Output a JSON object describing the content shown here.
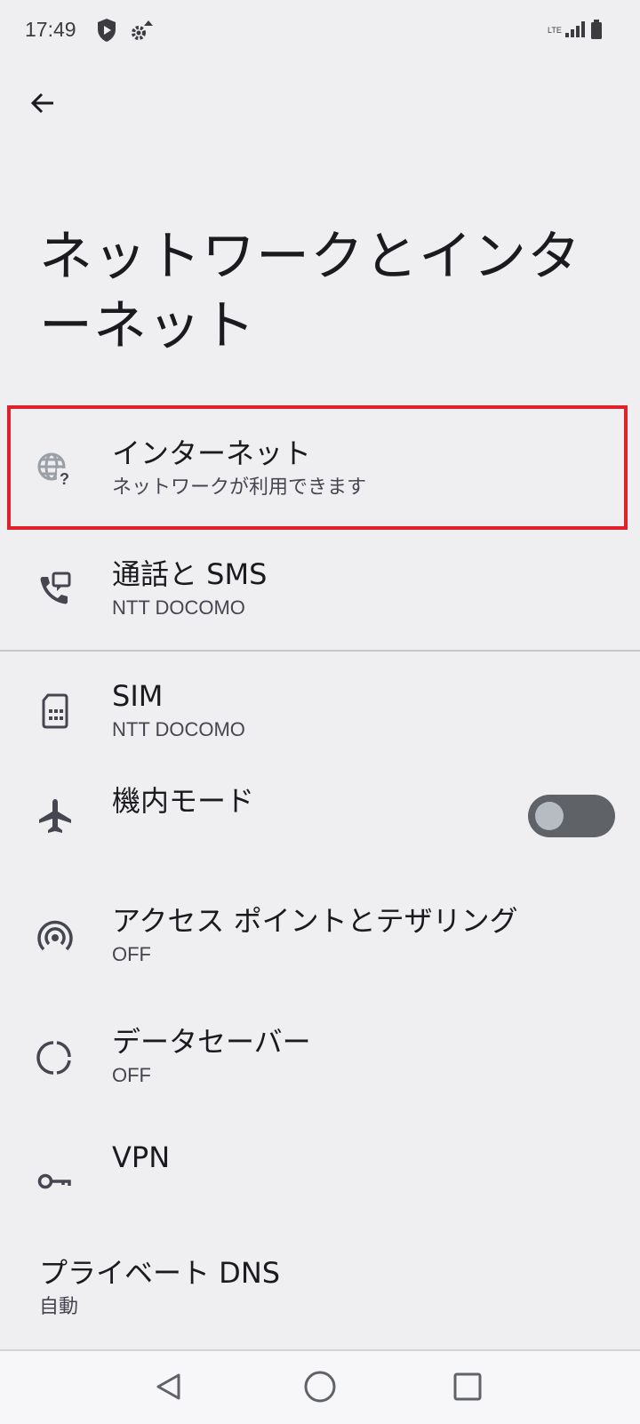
{
  "status_bar": {
    "time": "17:49",
    "icons": [
      "shield-play-icon",
      "settings-wifi-icon",
      "lte-signal-icon",
      "battery-icon"
    ],
    "network_type": "LTE"
  },
  "header": {
    "back_icon": "arrow-back-icon",
    "title": "ネットワークとインターネット"
  },
  "settings": {
    "internet": {
      "icon": "globe-question-icon",
      "label": "インターネット",
      "sub": "ネットワークが利用できます"
    },
    "calls_sms": {
      "icon": "phone-sms-icon",
      "label": "通話と SMS",
      "sub": "NTT DOCOMO"
    },
    "sim": {
      "icon": "sim-card-icon",
      "label": "SIM",
      "sub": "NTT DOCOMO"
    },
    "airplane": {
      "icon": "airplane-icon",
      "label": "機内モード",
      "toggle_on": false
    },
    "hotspot": {
      "icon": "hotspot-icon",
      "label": "アクセス ポイントとテザリング",
      "sub": "OFF"
    },
    "data_saver": {
      "icon": "data-saver-icon",
      "label": "データセーバー",
      "sub": "OFF"
    },
    "vpn": {
      "icon": "key-icon",
      "label": "VPN"
    },
    "private_dns": {
      "label": "プライベート DNS",
      "sub": "自動"
    }
  },
  "highlight_color": "#e0202a",
  "nav_bar": {
    "icons": [
      "back-triangle-icon",
      "home-circle-icon",
      "recents-square-icon"
    ]
  }
}
